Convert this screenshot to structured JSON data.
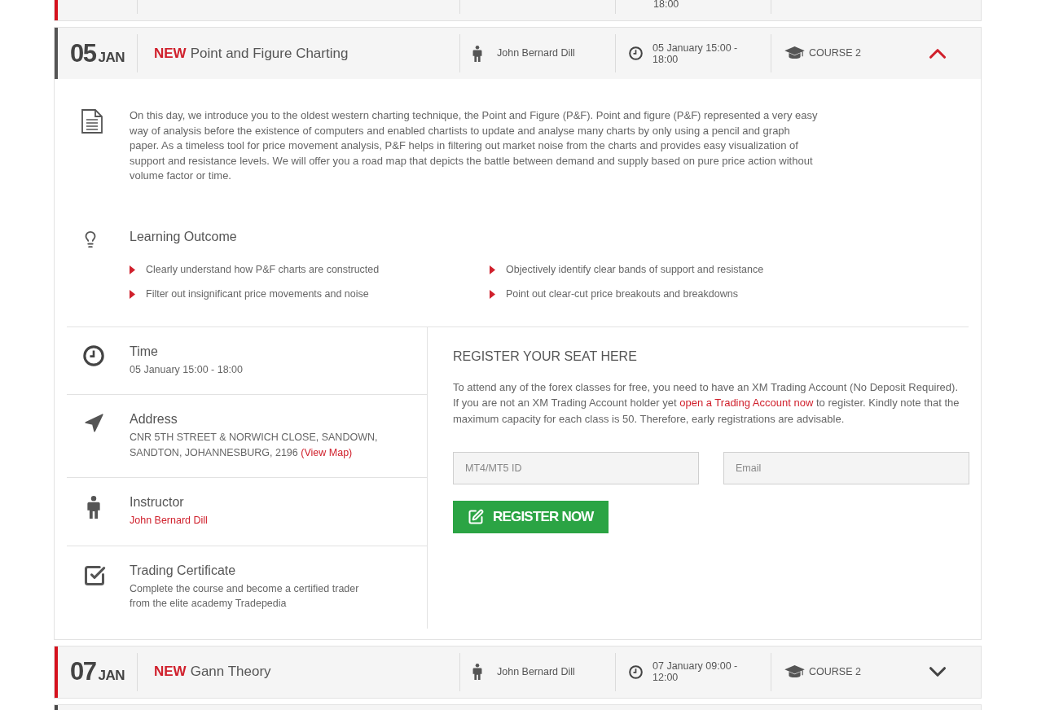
{
  "sessions": [
    {
      "kind": "cut_top",
      "color": "#d6121e",
      "time": "18:00"
    },
    {
      "kind": "full",
      "color": "#555555",
      "day": "05",
      "month": "JAN",
      "badge": "NEW",
      "title": "Point and Figure Charting",
      "instructor": "John Bernard Dill",
      "time": "05 January 15:00 - 18:00",
      "course": "COURSE 2",
      "expanded": true,
      "details": {
        "description": "On this day, we introduce you to the oldest western charting technique, the Point and Figure (P&F). Point and figure (P&F) represented a very easy way of analysis before the existence of computers and enabled chartists to update and analyse many charts by only using a pencil and graph paper. As a timeless tool for price movement analysis, P&F helps in filtering out market noise from the charts and provides easy visualization of support and resistance levels. We will offer you a road map that depicts the battle between demand and supply based on pure price action without volume factor or time.",
        "outcome": {
          "title": "Learning Outcome",
          "items": [
            "Clearly understand how P&F charts are constructed",
            "Objectively identify clear bands of support and resistance",
            "Filter out insignificant price movements and noise",
            "Point out clear-cut price breakouts and breakdowns"
          ]
        },
        "info": [
          {
            "kind": "time",
            "title": "Time",
            "text": "05 January 15:00 - 18:00"
          },
          {
            "kind": "address",
            "title": "Address",
            "text": "CNR 5TH STREET & NORWICH CLOSE, SANDOWN, SANDTON, JOHANNESBURG, 2196",
            "link": "(View Map)"
          },
          {
            "kind": "instructor",
            "title": "Instructor",
            "link": "John Bernard Dill"
          },
          {
            "kind": "certificate",
            "title": "Trading Certificate",
            "text": "Complete the course and become a certified trader from the elite academy Tradepedia"
          }
        ],
        "register": {
          "title": "REGISTER YOUR SEAT HERE",
          "text_before": "To attend any of the forex classes for free, you need to have an XM Trading Account (No Deposit Required). If you are not an XM Trading Account holder yet",
          "link": "open a Trading Account now",
          "text_after": "to register. Kindly note that the maximum capacity for each class is 50. Therefore, early registrations are advisable.",
          "fields": [
            {
              "placeholder": "MT4/MT5 ID"
            },
            {
              "placeholder": "Email"
            }
          ],
          "button": "REGISTER NOW"
        }
      }
    },
    {
      "kind": "full",
      "color": "#d6121e",
      "day": "07",
      "month": "JAN",
      "badge": "NEW",
      "title": "Gann Theory",
      "instructor": "John Bernard Dill",
      "time": "07 January 09:00 - 12:00",
      "course": "COURSE 2",
      "expanded": false
    },
    {
      "kind": "cut_bottom",
      "color": "#4a4a4a"
    }
  ]
}
